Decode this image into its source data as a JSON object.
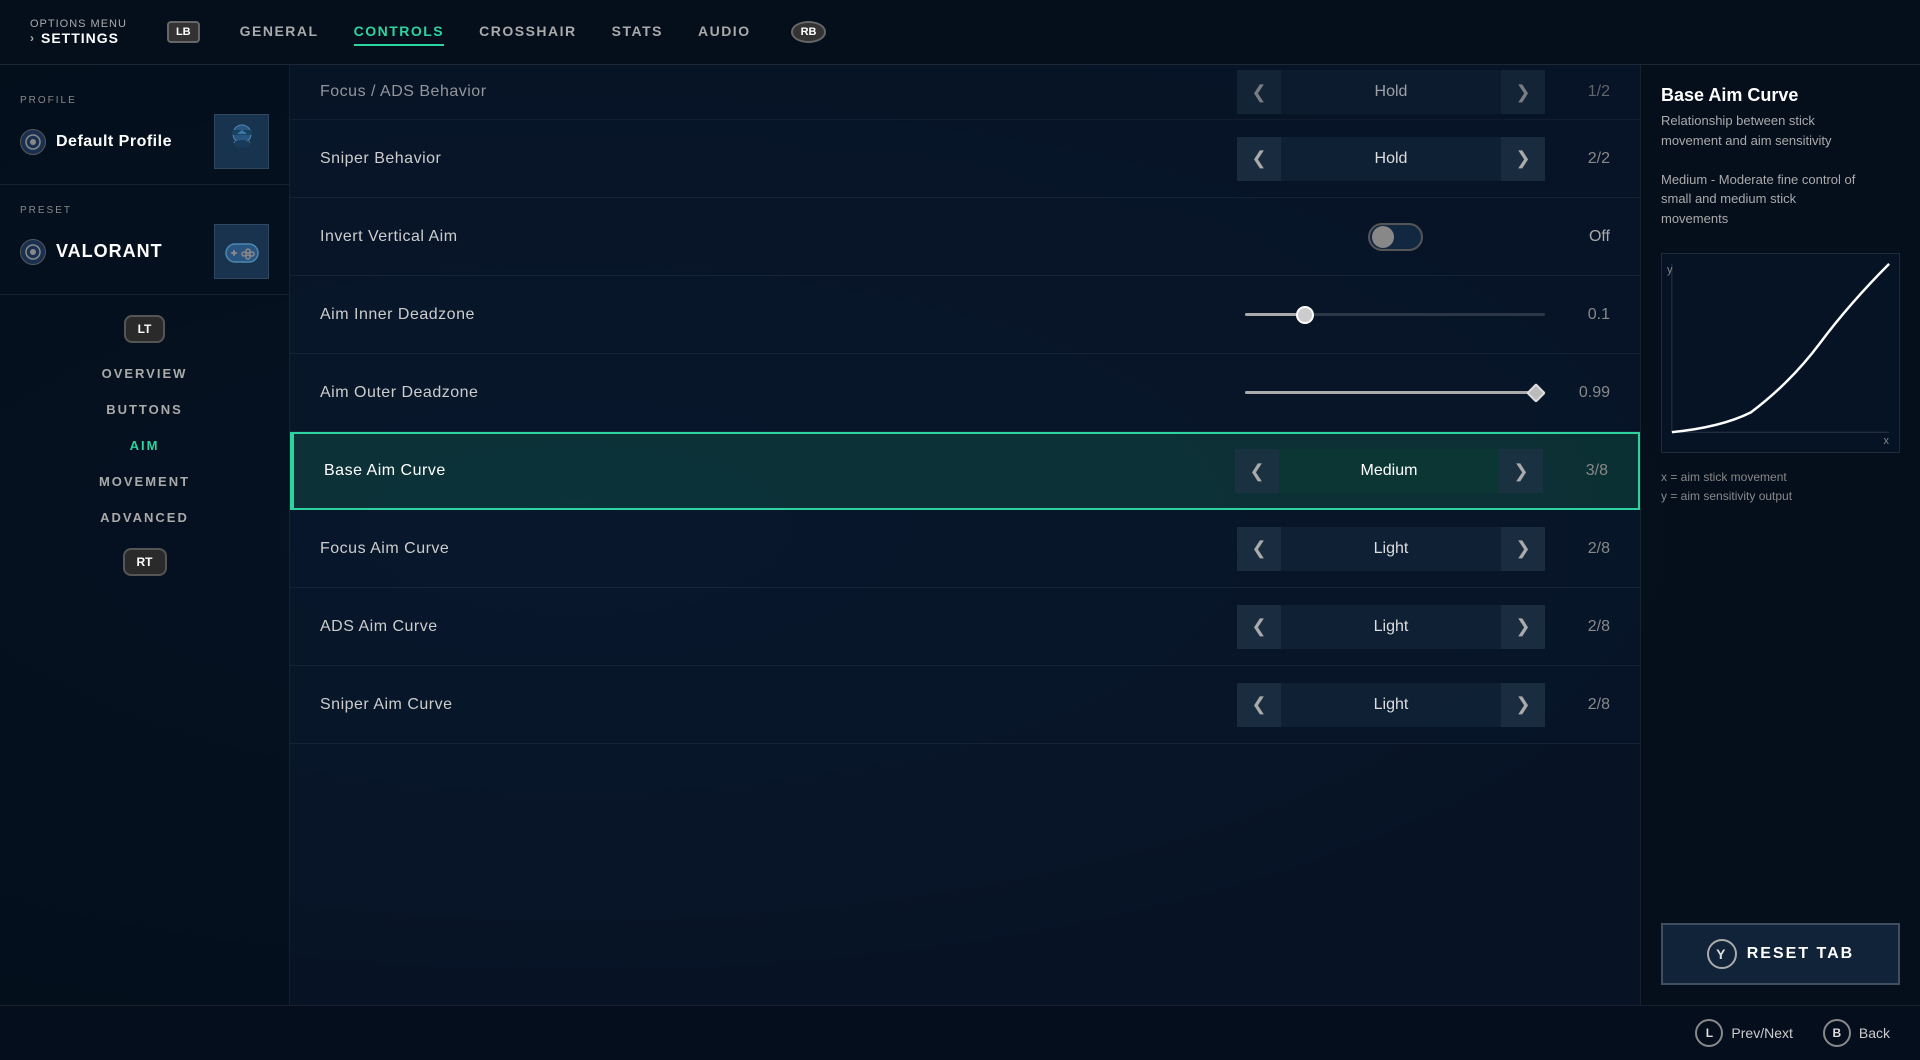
{
  "topNav": {
    "optionsLabel": "OPTIONS MENU",
    "settingsLabel": "SETTINGS",
    "lbButton": "LB",
    "rbButton": "RB",
    "tabs": [
      {
        "id": "general",
        "label": "GENERAL",
        "active": false
      },
      {
        "id": "controls",
        "label": "CONTROLS",
        "active": true
      },
      {
        "id": "crosshair",
        "label": "CROSSHAIR",
        "active": false
      },
      {
        "id": "stats",
        "label": "STATS",
        "active": false
      },
      {
        "id": "audio",
        "label": "AUDIO",
        "active": false
      }
    ]
  },
  "sidebar": {
    "profileLabel": "PROFILE",
    "profileName": "Default Profile",
    "presetLabel": "PRESET",
    "presetName": "VALORANT",
    "ltButton": "LT",
    "rtButton": "RT",
    "navItems": [
      {
        "id": "overview",
        "label": "OVERVIEW",
        "active": false
      },
      {
        "id": "buttons",
        "label": "BUTTONS",
        "active": false
      },
      {
        "id": "aim",
        "label": "AIM",
        "active": true
      },
      {
        "id": "movement",
        "label": "MOVEMENT",
        "active": false
      },
      {
        "id": "advanced",
        "label": "ADVANCED",
        "active": false
      }
    ]
  },
  "settings": {
    "rows": [
      {
        "id": "focus-ads-behavior",
        "label": "Focus / ADS Behavior",
        "controlType": "selector",
        "value": "Hold",
        "count": "1/2",
        "highlighted": false,
        "partial": true
      },
      {
        "id": "sniper-behavior",
        "label": "Sniper Behavior",
        "controlType": "selector",
        "value": "Hold",
        "count": "2/2",
        "highlighted": false
      },
      {
        "id": "invert-vertical-aim",
        "label": "Invert Vertical Aim",
        "controlType": "toggle",
        "value": "Off",
        "highlighted": false
      },
      {
        "id": "aim-inner-deadzone",
        "label": "Aim Inner Deadzone",
        "controlType": "slider",
        "value": "0.1",
        "sliderPercent": 20,
        "sliderType": "circle",
        "highlighted": false
      },
      {
        "id": "aim-outer-deadzone",
        "label": "Aim Outer Deadzone",
        "controlType": "slider",
        "value": "0.99",
        "sliderPercent": 97,
        "sliderType": "diamond",
        "highlighted": false
      },
      {
        "id": "base-aim-curve",
        "label": "Base Aim Curve",
        "controlType": "selector",
        "value": "Medium",
        "count": "3/8",
        "highlighted": true
      },
      {
        "id": "focus-aim-curve",
        "label": "Focus Aim Curve",
        "controlType": "selector",
        "value": "Light",
        "count": "2/8",
        "highlighted": false
      },
      {
        "id": "ads-aim-curve",
        "label": "ADS Aim Curve",
        "controlType": "selector",
        "value": "Light",
        "count": "2/8",
        "highlighted": false
      },
      {
        "id": "sniper-aim-curve",
        "label": "Sniper Aim Curve",
        "controlType": "selector",
        "value": "Light",
        "count": "2/8",
        "highlighted": false
      }
    ]
  },
  "rightPanel": {
    "title": "Base Aim Curve",
    "descLine1": "Relationship between stick",
    "descLine2": "movement and aim sensitivity",
    "descLine3": "",
    "descLine4": "Medium - Moderate fine control of",
    "descLine5": "small and medium stick",
    "descLine6": "movements",
    "axisXLabel": "x",
    "axisYLabel": "y",
    "axisNoteX": "x = aim stick movement",
    "axisNoteY": "y = aim sensitivity output",
    "resetTabLabel": "RESET TAB",
    "yButtonLabel": "Y"
  },
  "bottomBar": {
    "prevNextLabel": "Prev/Next",
    "backLabel": "Back",
    "lButtonLabel": "L",
    "bButtonLabel": "B"
  }
}
